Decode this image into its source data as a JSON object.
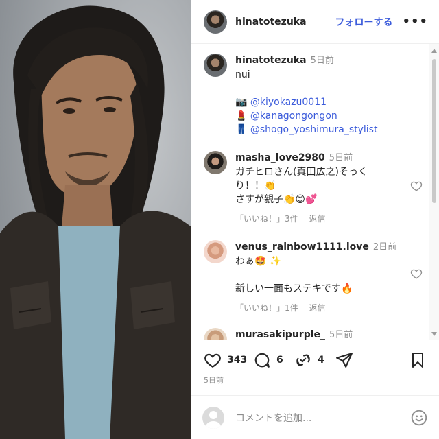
{
  "post": {
    "author": "hinatotezuka",
    "follow_label": "フォローする",
    "more_label": "•••",
    "caption": {
      "username": "hinatotezuka",
      "time": "5日前",
      "text": "nui",
      "credits": [
        {
          "emoji": "📷",
          "handle": "@kiyokazu0011"
        },
        {
          "emoji": "💄",
          "handle": "@kanagongongon"
        },
        {
          "emoji": "👖",
          "handle": "@shogo_yoshimura_stylist"
        }
      ]
    }
  },
  "comments": [
    {
      "username": "masha_love2980",
      "time": "5日前",
      "lines": [
        "ガチヒロさん(真田広之)そっく",
        "り！！👏",
        "さすが親子👏😊💕"
      ],
      "likes": "「いいね！」3件",
      "reply": "返信"
    },
    {
      "username": "venus_rainbow1111.love",
      "time": "2日前",
      "lines": [
        "わぁ🤩 ✨",
        "",
        "新しい一面もステキです🔥"
      ],
      "likes": "「いいね！」1件",
      "reply": "返信"
    },
    {
      "username": "murasakipurple_",
      "time": "5日前"
    }
  ],
  "actions": {
    "likes": "343",
    "comments": "6",
    "reposts": "4",
    "date": "5日前"
  },
  "add_comment": {
    "placeholder": "コメントを追加..."
  }
}
